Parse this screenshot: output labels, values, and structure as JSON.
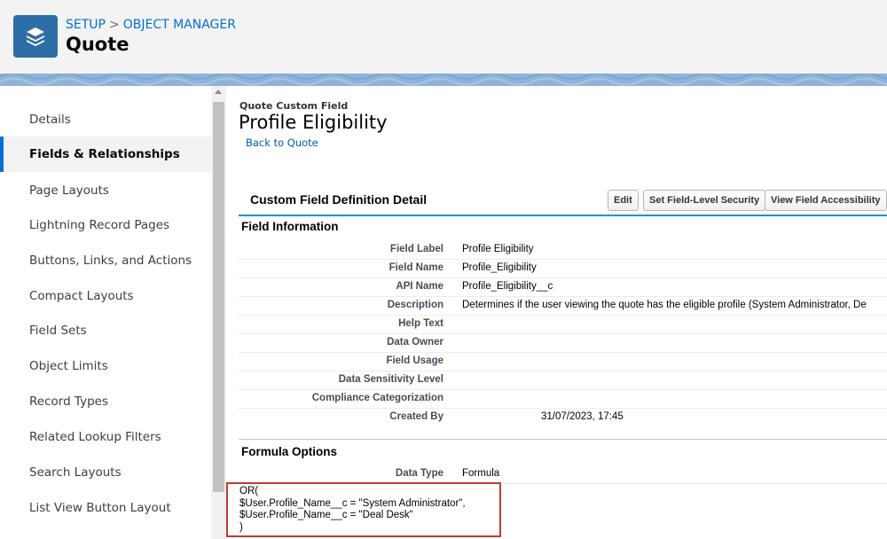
{
  "header": {
    "breadcrumb": [
      "SETUP",
      "OBJECT MANAGER"
    ],
    "breadcrumb_sep": ">",
    "title": "Quote",
    "icon": "layers-icon",
    "icon_color": "#2e6ea6"
  },
  "sidebar": {
    "items": [
      {
        "label": "Details",
        "active": false
      },
      {
        "label": "Fields & Relationships",
        "active": true
      },
      {
        "label": "Page Layouts",
        "active": false
      },
      {
        "label": "Lightning Record Pages",
        "active": false
      },
      {
        "label": "Buttons, Links, and Actions",
        "active": false
      },
      {
        "label": "Compact Layouts",
        "active": false
      },
      {
        "label": "Field Sets",
        "active": false
      },
      {
        "label": "Object Limits",
        "active": false
      },
      {
        "label": "Record Types",
        "active": false
      },
      {
        "label": "Related Lookup Filters",
        "active": false
      },
      {
        "label": "Search Layouts",
        "active": false
      },
      {
        "label": "List View Button Layout",
        "active": false
      }
    ]
  },
  "main": {
    "field_type": "Quote Custom Field",
    "field_title": "Profile Eligibility",
    "back_link": "Back to Quote",
    "section_title": "Custom Field Definition Detail",
    "buttons": [
      "Edit",
      "Set Field-Level Security",
      "View Field Accessibility"
    ],
    "field_information": {
      "title": "Field Information",
      "rows": [
        {
          "label": "Field Label",
          "value": "Profile Eligibility"
        },
        {
          "label": "Field Name",
          "value": "Profile_Eligibility"
        },
        {
          "label": "API Name",
          "value": "Profile_Eligibility__c"
        },
        {
          "label": "Description",
          "value": "Determines if the user viewing the quote has the eligible profile (System Administrator, De"
        },
        {
          "label": "Help Text",
          "value": ""
        },
        {
          "label": "Data Owner",
          "value": ""
        },
        {
          "label": "Field Usage",
          "value": ""
        },
        {
          "label": "Data Sensitivity Level",
          "value": ""
        },
        {
          "label": "Compliance Categorization",
          "value": ""
        },
        {
          "label": "Created By",
          "value": "31/07/2023, 17:45"
        }
      ]
    },
    "formula_options": {
      "title": "Formula Options",
      "rows": [
        {
          "label": "Data Type",
          "value": "Formula"
        }
      ]
    },
    "formula_lines": [
      "OR(",
      "$User.Profile_Name__c = \"System Administrator\",",
      "$User.Profile_Name__c = \"Deal Desk\"",
      ")"
    ],
    "highlight_color": "#c23934"
  }
}
